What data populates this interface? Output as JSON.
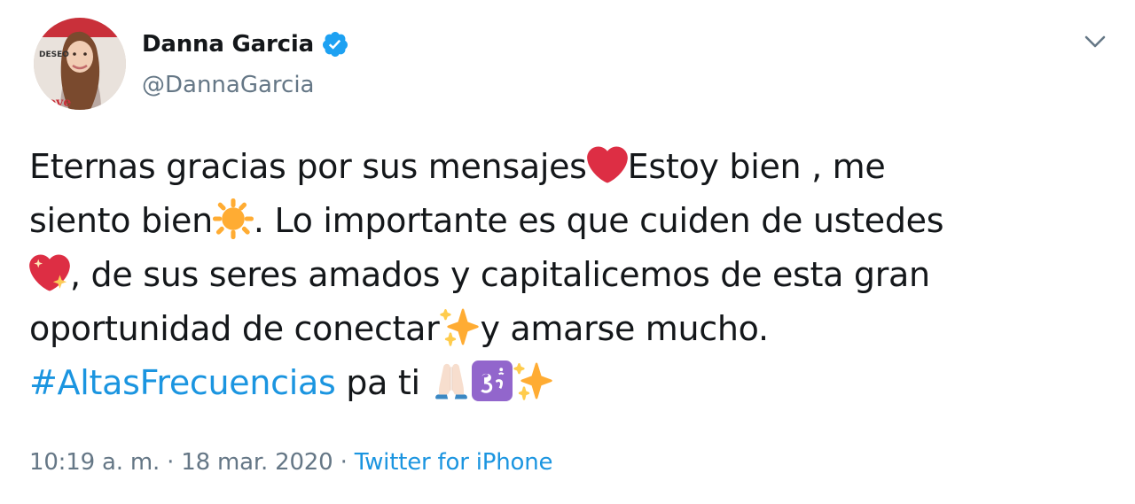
{
  "author": {
    "display_name": "Danna Garcia",
    "handle": "@DannaGarcia",
    "verified": true,
    "avatar_cover_text": [
      "DESEO",
      "Love"
    ]
  },
  "tweet": {
    "lines": [
      [
        "Eternas gracias por sus mensajes",
        "Estoy bien , me"
      ],
      [
        "siento bien",
        ". Lo importante es que cuiden de ustedes"
      ],
      [
        ", de sus seres amados y capitalicemos de esta gran"
      ],
      [
        "oportunidad de conectar",
        "y amarse mucho."
      ]
    ],
    "hashtag": "#AltasFrecuencias",
    "tail_text": "pa ti",
    "emojis": [
      "red-heart",
      "sun",
      "sparkling-heart",
      "sparkles",
      "folded-hands",
      "om",
      "sparkles"
    ]
  },
  "meta": {
    "time": "10:19 a. m.",
    "separator": "·",
    "date": "18 mar. 2020",
    "source": "Twitter for iPhone"
  },
  "colors": {
    "text": "#14171a",
    "secondary": "#657786",
    "link": "#1b95e0",
    "verified": "#1da1f2"
  }
}
